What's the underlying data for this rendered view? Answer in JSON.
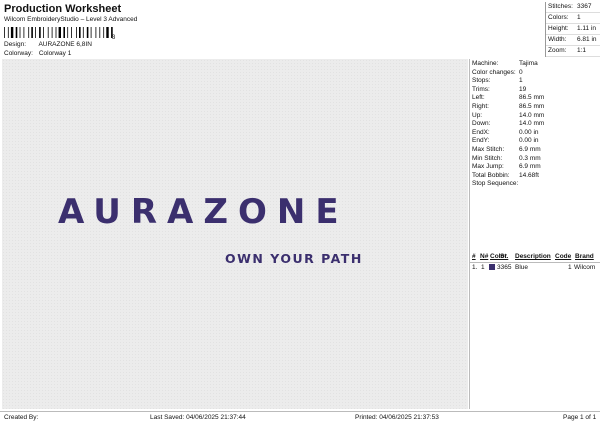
{
  "header": {
    "title": "Production Worksheet",
    "subtitle": "Wilcom EmbroideryStudio – Level 3 Advanced",
    "barcode_number": "3",
    "design_label": "Design:",
    "design_value": "AURAZONE 6,8IN",
    "colorway_label": "Colorway:",
    "colorway_value": "Colorway 1"
  },
  "stats": [
    {
      "label": "Stitches:",
      "value": "3367"
    },
    {
      "label": "Colors:",
      "value": "1"
    },
    {
      "label": "Height:",
      "value": "1.11 in"
    },
    {
      "label": "Width:",
      "value": "6.81 in"
    },
    {
      "label": "Zoom:",
      "value": "1:1"
    }
  ],
  "design": {
    "main_text": "AURAZONE",
    "tagline": "OWN YOUR PATH",
    "thread_color": "#3b2f6e"
  },
  "machine": [
    {
      "label": "Machine:",
      "value": "Tajima"
    },
    {
      "label": "Color changes:",
      "value": "0"
    },
    {
      "label": "Stops:",
      "value": "1"
    },
    {
      "label": "Trims:",
      "value": "19"
    },
    {
      "label": "Left:",
      "value": "86.5 mm"
    },
    {
      "label": "Right:",
      "value": "86.5 mm"
    },
    {
      "label": "Up:",
      "value": "14.0 mm"
    },
    {
      "label": "Down:",
      "value": "14.0 mm"
    },
    {
      "label": "EndX:",
      "value": "0.00 in"
    },
    {
      "label": "EndY:",
      "value": "0.00 in"
    },
    {
      "label": "Max Stitch:",
      "value": "6.9 mm"
    },
    {
      "label": "Min Stitch:",
      "value": "0.3 mm"
    },
    {
      "label": "Max Jump:",
      "value": "6.9 mm"
    },
    {
      "label": "Total Bobbin:",
      "value": "14.68ft"
    },
    {
      "label": "Stop Sequence:",
      "value": ""
    }
  ],
  "sequence": {
    "headers": [
      "#",
      "N#",
      "Color",
      "St.",
      "Description",
      "Code",
      "Brand"
    ],
    "row": {
      "num": "1.",
      "n": "1",
      "stitches": "3365",
      "description": "Blue",
      "code": "1",
      "brand": "Wilcom"
    }
  },
  "footer": {
    "created_by": "Created By:",
    "last_saved": "Last Saved: 04/06/2025 21:37:44",
    "printed": "Printed: 04/06/2025 21:37:53",
    "page": "Page 1 of 1"
  }
}
